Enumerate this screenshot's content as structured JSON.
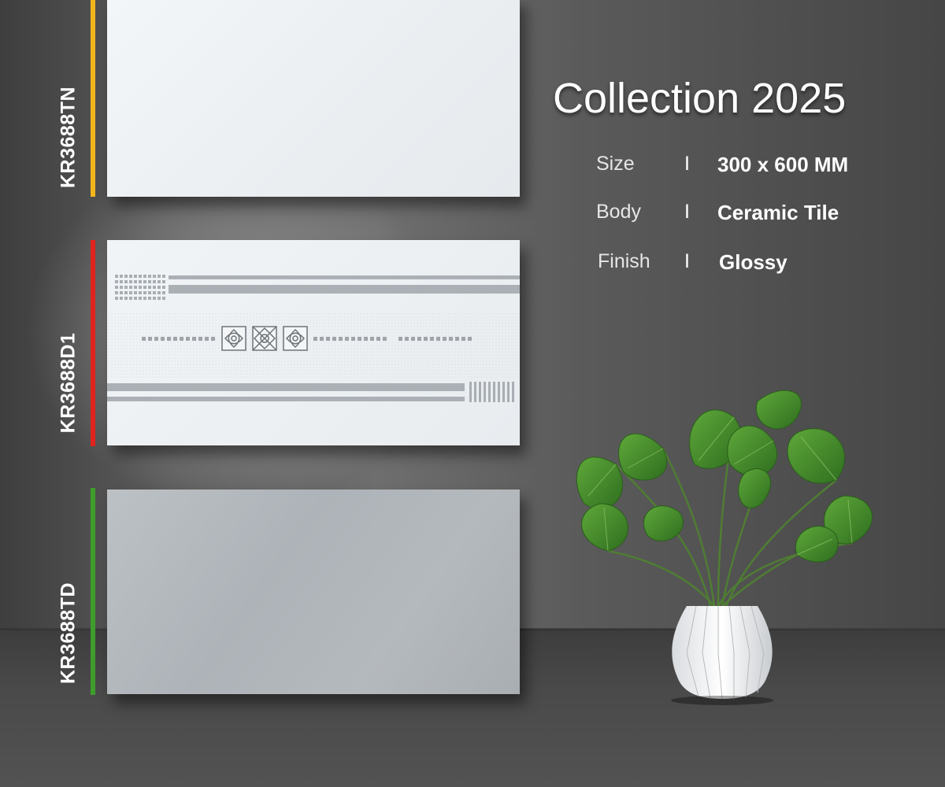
{
  "collection": {
    "title": "Collection 2025"
  },
  "specs": [
    {
      "label": "Size",
      "separator": "I",
      "value": "300 x 600 MM"
    },
    {
      "label": "Body",
      "separator": "I",
      "value": "Ceramic Tile"
    },
    {
      "label": "Finish",
      "separator": "I",
      "value": "Glossy"
    }
  ],
  "tiles": [
    {
      "code": "KR3688TN",
      "bar_color": "#f2b51c",
      "tile_color": "#eef1f4"
    },
    {
      "code": "KR3688D1",
      "bar_color": "#e0241d",
      "tile_color": "#eef1f4"
    },
    {
      "code": "KR3688TD",
      "bar_color": "#3f9d2b",
      "tile_color": "#b1b6ba"
    }
  ],
  "decor_icons": [
    "floral-motif-icon",
    "geometric-motif-icon",
    "floral-motif-icon"
  ],
  "props": {
    "plant": "potted-plant",
    "vase": "white-faceted-vase"
  }
}
